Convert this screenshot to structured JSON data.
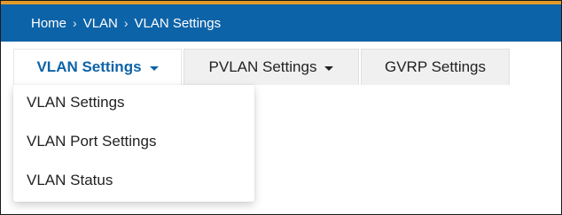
{
  "colors": {
    "header_bg": "#0d63a8",
    "accent_line": "#e39a2b",
    "active_tab_text": "#0d63a8"
  },
  "breadcrumb": {
    "items": [
      "Home",
      "VLAN",
      "VLAN Settings"
    ],
    "separator": "›"
  },
  "tabs": [
    {
      "label": "VLAN Settings",
      "icon": "caret-down-icon",
      "active": true
    },
    {
      "label": "PVLAN Settings",
      "icon": "caret-down-icon",
      "active": false
    },
    {
      "label": "GVRP Settings",
      "active": false
    }
  ],
  "dropdown": {
    "items": [
      "VLAN Settings",
      "VLAN Port Settings",
      "VLAN Status"
    ]
  }
}
